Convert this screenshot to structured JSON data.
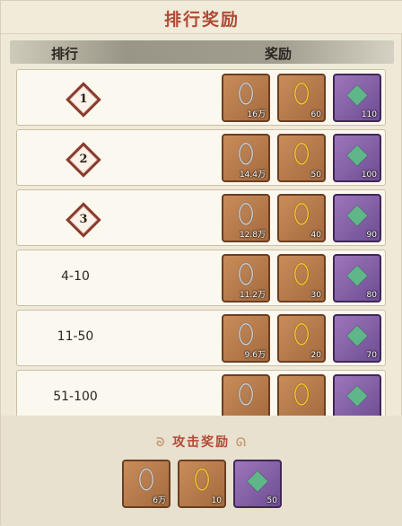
{
  "title": "排行奖励",
  "header": {
    "rank": "排行",
    "reward": "奖励"
  },
  "icons": {
    "silver": "silver-ingot-icon",
    "gold": "gold-ingot-icon",
    "gem": "green-gem-icon"
  },
  "rows": [
    {
      "rank": "1",
      "type": "badge",
      "rewards": [
        "16万",
        "60",
        "110"
      ]
    },
    {
      "rank": "2",
      "type": "badge",
      "rewards": [
        "14.4万",
        "50",
        "100"
      ]
    },
    {
      "rank": "3",
      "type": "badge",
      "rewards": [
        "12.8万",
        "40",
        "90"
      ]
    },
    {
      "rank": "4-10",
      "type": "text",
      "rewards": [
        "11.2万",
        "30",
        "80"
      ]
    },
    {
      "rank": "11-50",
      "type": "text",
      "rewards": [
        "9.6万",
        "20",
        "70"
      ]
    },
    {
      "rank": "51-100",
      "type": "text",
      "rewards": [
        "",
        "",
        ""
      ]
    }
  ],
  "attack": {
    "title": "攻击奖励",
    "rewards": [
      "6万",
      "10",
      "50"
    ]
  }
}
